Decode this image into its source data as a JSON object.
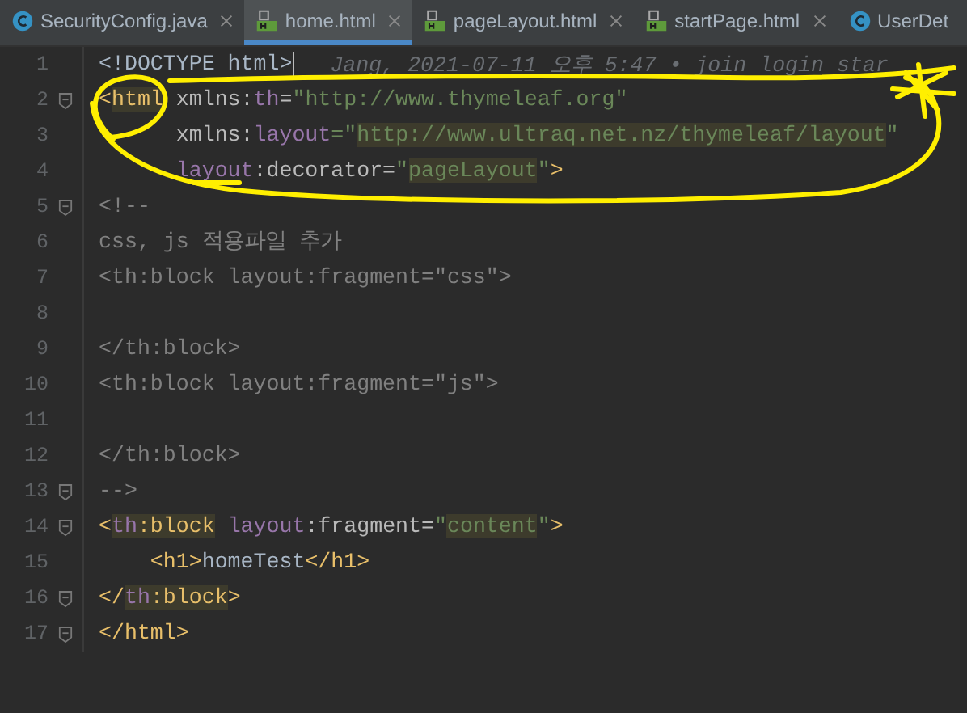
{
  "tabs": [
    {
      "label": "SecurityConfig.java",
      "kind": "java",
      "selected": false,
      "closable": true
    },
    {
      "label": "home.html",
      "kind": "html",
      "selected": true,
      "closable": true
    },
    {
      "label": "pageLayout.html",
      "kind": "html",
      "selected": false,
      "closable": true
    },
    {
      "label": "startPage.html",
      "kind": "html",
      "selected": false,
      "closable": true
    },
    {
      "label": "UserDet",
      "kind": "java",
      "selected": false,
      "closable": false
    }
  ],
  "editor": {
    "lines": [
      {
        "number": "1",
        "fold": false,
        "caret": true,
        "blame": "Jang, 2021-07-11 오후 5:47 • join login star",
        "tokens": [
          {
            "text": "<!DOCTYPE html>",
            "kind": "text",
            "highlighted": false
          }
        ]
      },
      {
        "number": "2",
        "fold": true,
        "caret": false,
        "tokens": [
          {
            "text": "<",
            "kind": "tag",
            "highlighted": false
          },
          {
            "text": "html",
            "kind": "tag",
            "highlighted": true
          },
          {
            "text": " xmlns:",
            "kind": "attr",
            "highlighted": false
          },
          {
            "text": "th",
            "kind": "ns",
            "highlighted": false
          },
          {
            "text": "=",
            "kind": "attr",
            "highlighted": false
          },
          {
            "text": "\"http://www.thymeleaf.org\"",
            "kind": "string",
            "highlighted": false
          }
        ]
      },
      {
        "number": "3",
        "fold": false,
        "caret": false,
        "tokens": [
          {
            "text": "      xmlns:",
            "kind": "attr",
            "highlighted": false
          },
          {
            "text": "layout",
            "kind": "ns",
            "highlighted": false
          },
          {
            "text": "=\"",
            "kind": "string",
            "highlighted": false
          },
          {
            "text": "http://www.ultraq.net.nz/thymeleaf/layout",
            "kind": "string",
            "highlighted": true
          },
          {
            "text": "\"",
            "kind": "string",
            "highlighted": false
          }
        ]
      },
      {
        "number": "4",
        "fold": false,
        "caret": false,
        "tokens": [
          {
            "text": "      layout",
            "kind": "ns",
            "highlighted": false
          },
          {
            "text": ":decorator=",
            "kind": "attr",
            "highlighted": false
          },
          {
            "text": "\"",
            "kind": "string",
            "highlighted": false
          },
          {
            "text": "pageLayout",
            "kind": "string",
            "highlighted": true
          },
          {
            "text": "\"",
            "kind": "string",
            "highlighted": false
          },
          {
            "text": ">",
            "kind": "tag",
            "highlighted": false
          }
        ]
      },
      {
        "number": "5",
        "fold": true,
        "caret": false,
        "tokens": [
          {
            "text": "<!--",
            "kind": "comment",
            "highlighted": false
          }
        ]
      },
      {
        "number": "6",
        "fold": false,
        "caret": false,
        "tokens": [
          {
            "text": "css, js 적용파일 추가",
            "kind": "comment",
            "highlighted": false
          }
        ]
      },
      {
        "number": "7",
        "fold": false,
        "caret": false,
        "tokens": [
          {
            "text": "<th:block layout:fragment=\"css\">",
            "kind": "comment",
            "highlighted": false
          }
        ]
      },
      {
        "number": "8",
        "fold": false,
        "caret": false
      },
      {
        "number": "9",
        "fold": false,
        "caret": false,
        "tokens": [
          {
            "text": "</th:block>",
            "kind": "comment",
            "highlighted": false
          }
        ]
      },
      {
        "number": "10",
        "fold": false,
        "caret": false,
        "tokens": [
          {
            "text": "<th:block layout:fragment=\"js\">",
            "kind": "comment",
            "highlighted": false
          }
        ]
      },
      {
        "number": "11",
        "fold": false,
        "caret": false
      },
      {
        "number": "12",
        "fold": false,
        "caret": false,
        "tokens": [
          {
            "text": "</th:block>",
            "kind": "comment",
            "highlighted": false
          }
        ]
      },
      {
        "number": "13",
        "fold": true,
        "caret": false,
        "tokens": [
          {
            "text": "-->",
            "kind": "comment",
            "highlighted": false
          }
        ]
      },
      {
        "number": "14",
        "fold": true,
        "caret": false,
        "tokens": [
          {
            "text": "<",
            "kind": "tag",
            "highlighted": false
          },
          {
            "text": "th",
            "kind": "ns",
            "highlighted": true
          },
          {
            "text": ":block",
            "kind": "tag",
            "highlighted": true
          },
          {
            "text": " layout",
            "kind": "ns",
            "highlighted": false
          },
          {
            "text": ":fragment=",
            "kind": "attr",
            "highlighted": false
          },
          {
            "text": "\"",
            "kind": "string",
            "highlighted": false
          },
          {
            "text": "content",
            "kind": "string",
            "highlighted": true
          },
          {
            "text": "\"",
            "kind": "string",
            "highlighted": false
          },
          {
            "text": ">",
            "kind": "tag",
            "highlighted": false
          }
        ]
      },
      {
        "number": "15",
        "fold": false,
        "caret": false,
        "tokens": [
          {
            "text": "    <h1>",
            "kind": "tag",
            "highlighted": false
          },
          {
            "text": "homeTest",
            "kind": "text",
            "highlighted": false
          },
          {
            "text": "</h1>",
            "kind": "tag",
            "highlighted": false
          }
        ]
      },
      {
        "number": "16",
        "fold": true,
        "caret": false,
        "tokens": [
          {
            "text": "</",
            "kind": "tag",
            "highlighted": false
          },
          {
            "text": "th",
            "kind": "ns",
            "highlighted": true
          },
          {
            "text": ":block",
            "kind": "tag",
            "highlighted": true
          },
          {
            "text": ">",
            "kind": "tag",
            "highlighted": false
          }
        ]
      },
      {
        "number": "17",
        "fold": true,
        "caret": false,
        "tokens": [
          {
            "text": "</html>",
            "kind": "tag",
            "highlighted": false
          }
        ]
      }
    ]
  }
}
